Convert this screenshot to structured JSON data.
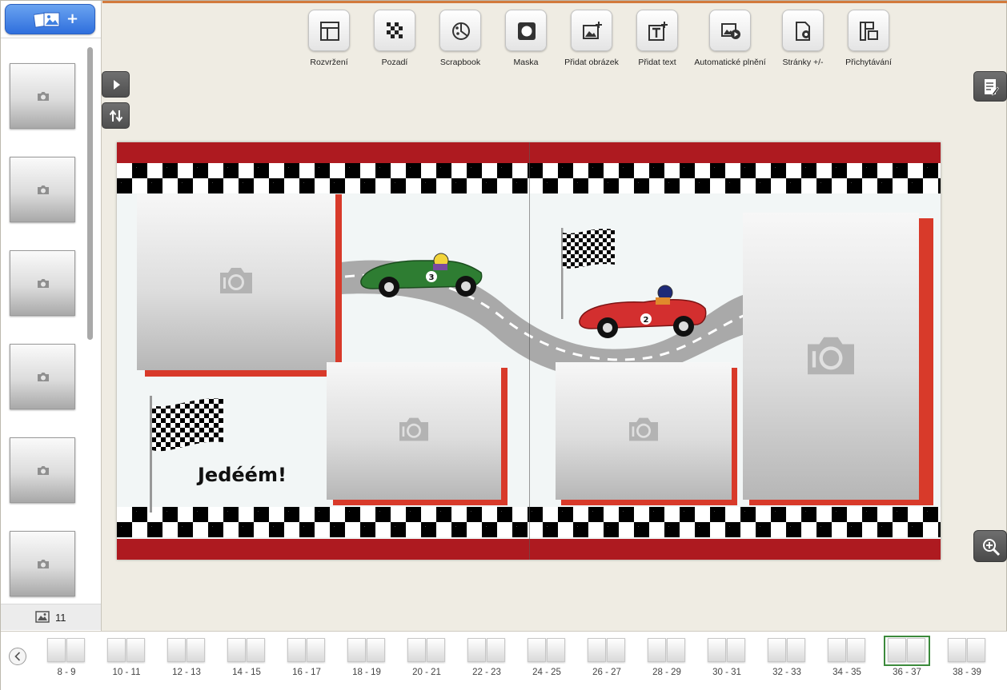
{
  "sidebar": {
    "add_button_plus": "+",
    "thumbnails": [
      {
        "icon": "camera-icon"
      },
      {
        "icon": "camera-icon"
      },
      {
        "icon": "camera-icon"
      },
      {
        "icon": "camera-icon"
      },
      {
        "icon": "camera-icon"
      },
      {
        "icon": "camera-icon"
      }
    ],
    "photo_count": "11"
  },
  "toolbar": {
    "items": [
      {
        "label": "Rozvržení",
        "icon": "layout-icon"
      },
      {
        "label": "Pozadí",
        "icon": "background-icon"
      },
      {
        "label": "Scrapbook",
        "icon": "scrapbook-icon"
      },
      {
        "label": "Maska",
        "icon": "mask-icon"
      },
      {
        "label": "Přidat obrázek",
        "icon": "add-image-icon"
      },
      {
        "label": "Přidat text",
        "icon": "add-text-icon"
      },
      {
        "label": "Automatické plnění",
        "icon": "autofill-icon"
      },
      {
        "label": "Stránky +/-",
        "icon": "pages-icon"
      },
      {
        "label": "Přichytávání",
        "icon": "snap-icon"
      }
    ]
  },
  "canvas": {
    "caption": "Jedéém!",
    "car_numbers": [
      "3",
      "2"
    ],
    "colors": {
      "red_band": "#ae1a20",
      "accent_shadow": "#d83a2a",
      "background": "#f2f6f6"
    }
  },
  "pages": {
    "items": [
      "8 - 9",
      "10 - 11",
      "12 - 13",
      "14 - 15",
      "16 - 17",
      "18 - 19",
      "20 - 21",
      "22 - 23",
      "24 - 25",
      "26 - 27",
      "28 - 29",
      "30 - 31",
      "32 - 33",
      "34 - 35",
      "36 - 37",
      "38 - 39"
    ],
    "selected": "36 - 37"
  }
}
